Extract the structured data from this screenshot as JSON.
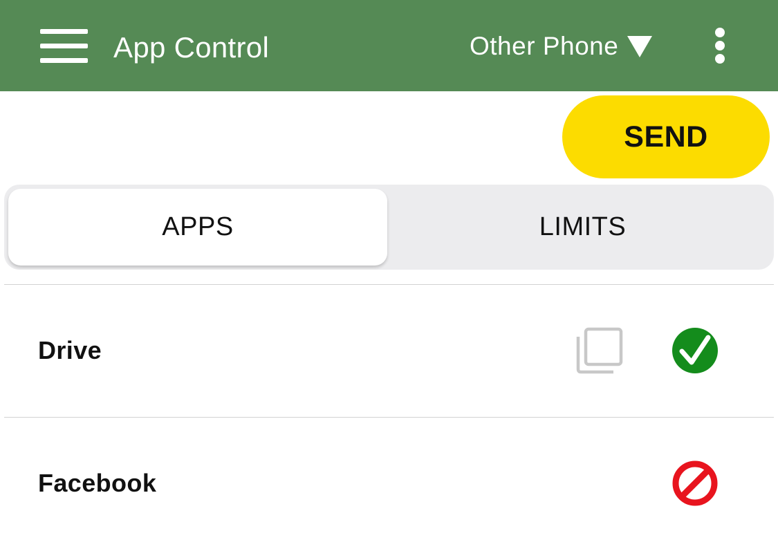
{
  "app_bar": {
    "menu_icon": "hamburger-menu-icon",
    "title": "App Control",
    "device_selector": {
      "label": "Other Phone",
      "icon": "dropdown-triangle-icon"
    },
    "overflow_icon": "vertical-ellipsis-icon",
    "background_color": "#558a55"
  },
  "actions": {
    "send_label": "SEND",
    "send_color": "#fcdc00"
  },
  "tabs": [
    {
      "label": "APPS",
      "active": true
    },
    {
      "label": "LIMITS",
      "active": false
    }
  ],
  "apps": [
    {
      "name": "Drive",
      "copy_icon": "copy-icon",
      "status": "allowed",
      "status_icon": "green-checkmark-icon",
      "status_color": "#148c1c"
    },
    {
      "name": "Facebook",
      "status": "blocked",
      "status_icon": "red-prohibited-icon",
      "status_color": "#e8141e"
    }
  ]
}
